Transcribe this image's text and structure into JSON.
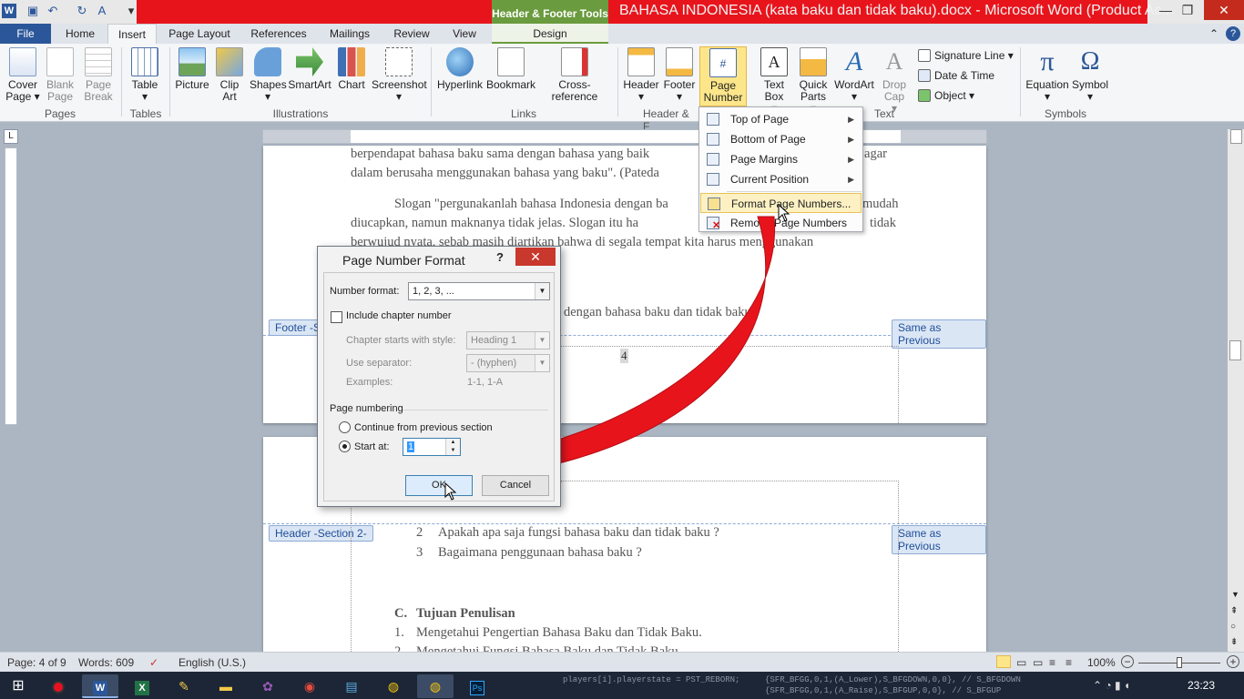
{
  "window": {
    "title": "BAHASA INDONESIA (kata baku dan tidak baku).docx  -  Microsoft Word (Product Ac...",
    "contextual_tab_group": "Header & Footer Tools"
  },
  "tabs": [
    "File",
    "Home",
    "Insert",
    "Page Layout",
    "References",
    "Mailings",
    "Review",
    "View",
    "Design"
  ],
  "ribbon": {
    "pages": {
      "label": "Pages",
      "cover": "Cover Page",
      "blank": "Blank Page",
      "break": "Page Break"
    },
    "tables": {
      "label": "Tables",
      "table": "Table"
    },
    "illustrations": {
      "label": "Illustrations",
      "picture": "Picture",
      "clipart": "Clip Art",
      "shapes": "Shapes",
      "smartart": "SmartArt",
      "chart": "Chart",
      "screenshot": "Screenshot"
    },
    "links": {
      "label": "Links",
      "hyperlink": "Hyperlink",
      "bookmark": "Bookmark",
      "crossref": "Cross-reference"
    },
    "headerfooter": {
      "label": "Header & F",
      "header": "Header",
      "footer": "Footer",
      "pagenumber": "Page Number"
    },
    "text": {
      "label": "Text",
      "textbox": "Text Box",
      "quickparts": "Quick Parts",
      "wordart": "WordArt",
      "dropcap": "Drop Cap",
      "signature": "Signature Line",
      "datetime": "Date & Time",
      "object": "Object"
    },
    "symbols": {
      "label": "Symbols",
      "equation": "Equation",
      "symbol": "Symbol"
    }
  },
  "menu": {
    "items": [
      "Top of Page",
      "Bottom of Page",
      "Page Margins",
      "Current Position",
      "Format Page Numbers...",
      "Remove Page Numbers"
    ]
  },
  "dialog": {
    "title": "Page Number Format",
    "help": "?",
    "number_format_label": "Number format:",
    "number_format_value": "1, 2, 3, ...",
    "include_chapter": "Include chapter number",
    "chapter_style_label": "Chapter starts with style:",
    "chapter_style_value": "Heading 1",
    "separator_label": "Use separator:",
    "separator_value": "-   (hyphen)",
    "examples_label": "Examples:",
    "examples_value": "1-1, 1-A",
    "page_numbering_label": "Page numbering",
    "continue_label": "Continue from previous section",
    "start_at_label": "Start at:",
    "start_at_value": "1",
    "ok": "OK",
    "cancel": "Cancel"
  },
  "document": {
    "line1": "berpendapat bahasa baku sama dengan bahasa yang baik",
    "line1_end": "a agar",
    "line2": "dalam  berusaha menggunakan bahasa yang baku\". (Pateda",
    "line3": "Slogan \"pergunakanlah bahasa Indonesia dengan ba",
    "line3_end": "mudah",
    "line4": "diucapkan, namun maknanya tidak jelas. Slogan itu ha",
    "line4_end": "tidak",
    "line5": "berwujud nyata, sebab masih diartikan bahwa di segala tempat kita harus menggunakan",
    "line6": "dengan bahasa baku dan tidak baku ?",
    "footer_label": "Footer -S",
    "same_as_previous": "Same as Previous",
    "footer_page_number": "4",
    "header_label": "Header -Section 2-",
    "item2_num": "2",
    "item2": "Apakah apa saja fungsi bahasa baku dan tidak baku ?",
    "item3_num": "3",
    "item3": "Bagaimana penggunaan bahasa baku ?",
    "heading_c": "C.",
    "heading_c_text": "Tujuan Penulisan",
    "list1_num": "1.",
    "list1": "Mengetahui Pengertian Bahasa Baku dan Tidak Baku.",
    "list2_num": "2.",
    "list2": "Mengetahui Fungsi Bahasa Baku dan Tidak Baku."
  },
  "status": {
    "page": "Page: 4 of 9",
    "words": "Words: 609",
    "language": "English (U.S.)",
    "zoom": "100%"
  },
  "taskbar": {
    "clock": "23:23",
    "code1": "players[i].playerstate = PST_REBORN;",
    "code2": "{SFR_BFGG,0,1,(A_Lower),S_BFGDOWN,0,0},     // S_BFGDOWN",
    "code3": "{SFR_BFGG,0,1,(A_Raise),S_BFGUP,0,0},  // S_BFGUP"
  },
  "colors": {
    "accent": "#2b579a",
    "context": "#6a9b3e",
    "arrow": "#e8141c"
  }
}
